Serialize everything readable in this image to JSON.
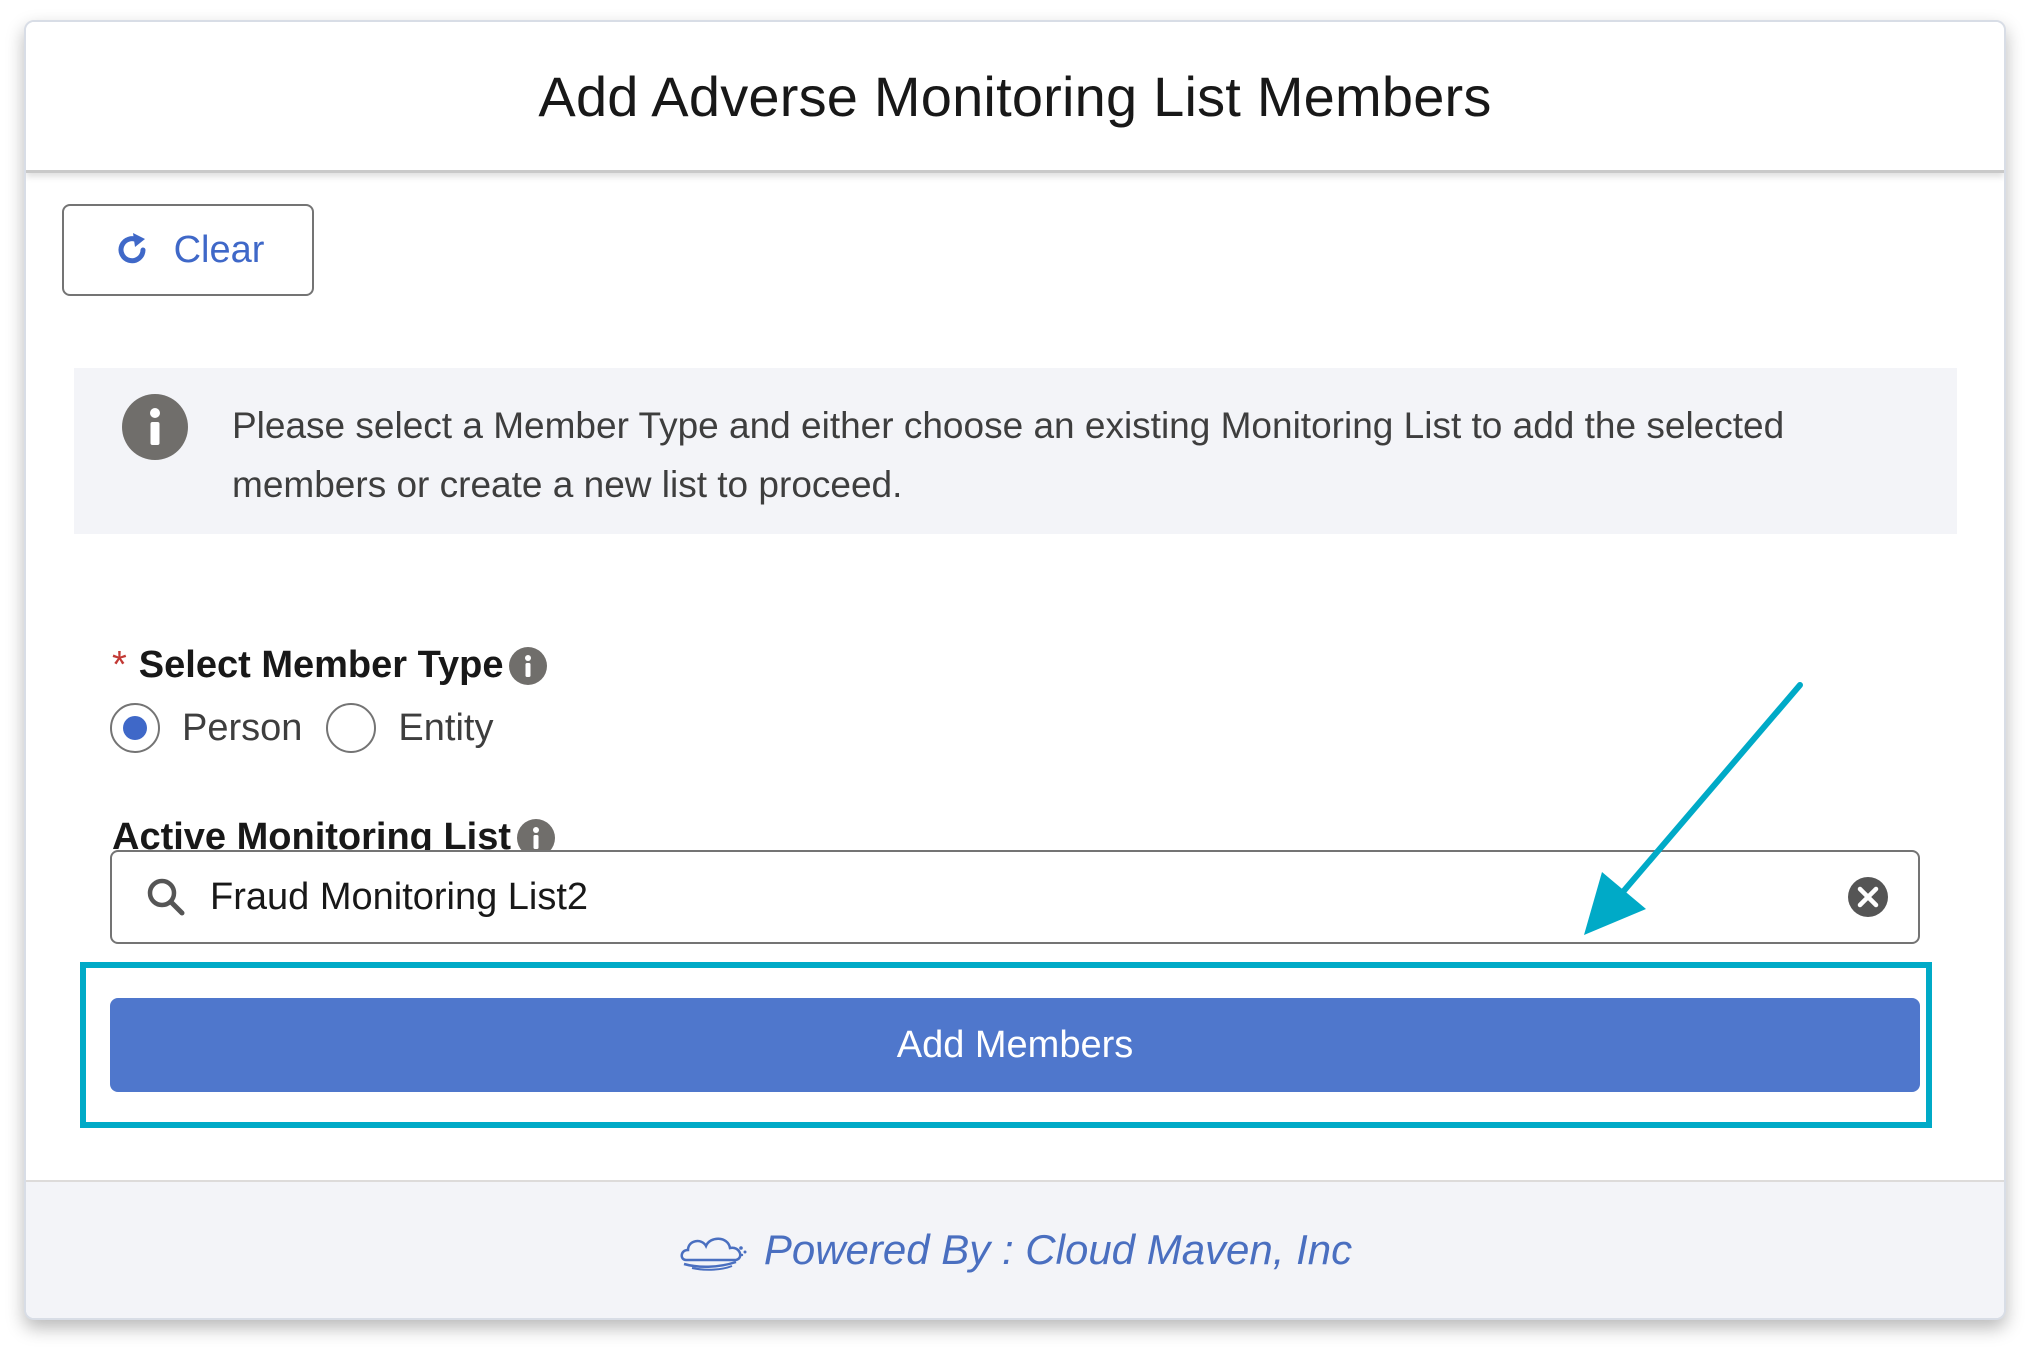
{
  "modal": {
    "title": "Add Adverse Monitoring List Members"
  },
  "toolbar": {
    "clear_label": "Clear"
  },
  "info_message": "Please select a Member Type and either choose an existing Monitoring List to add the selected members or create a new list to proceed.",
  "member_type": {
    "label": "Select Member Type",
    "required_marker": "*",
    "options": [
      {
        "label": "Person",
        "selected": true
      },
      {
        "label": "Entity",
        "selected": false
      }
    ]
  },
  "monitoring_list": {
    "label": "Active Monitoring List",
    "value": "Fraud Monitoring List2"
  },
  "add_button": {
    "label": "Add Members"
  },
  "footer": {
    "text": "Powered By : Cloud Maven, Inc"
  },
  "colors": {
    "brand_blue": "#4f77cc",
    "link_blue": "#3f68c8",
    "highlight": "#00aac7",
    "required_red": "#c23934",
    "icon_gray": "#706e6b"
  },
  "icons": {
    "clear": "refresh-icon",
    "info": "info-icon",
    "search": "search-icon",
    "input_clear": "clear-input-icon",
    "footer_logo": "cloud-logo-icon"
  }
}
